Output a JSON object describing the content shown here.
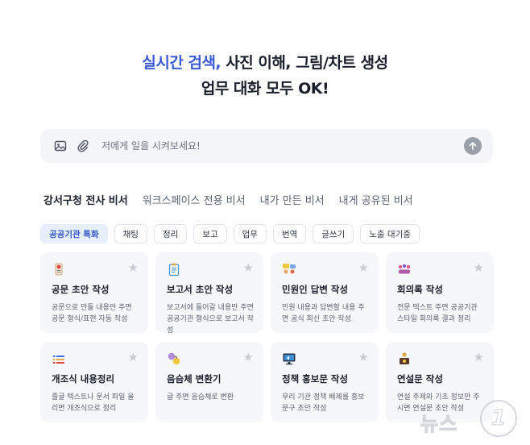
{
  "hero": {
    "accent": "실시간 검색,",
    "rest": " 사진 이해, 그림/차트 생성",
    "line2": "업무 대화 모두 OK!"
  },
  "chat": {
    "placeholder": "저에게 일을 시켜보세요!",
    "icons": [
      "image-icon",
      "paperclip-icon",
      "send-arrow-icon"
    ]
  },
  "tabs": [
    {
      "label": "강서구청 전사 비서",
      "active": true
    },
    {
      "label": "워크스페이스 전용 비서",
      "active": false
    },
    {
      "label": "내가 만든 비서",
      "active": false
    },
    {
      "label": "내게 공유된 비서",
      "active": false
    }
  ],
  "chips": [
    {
      "label": "공공기관 특화",
      "active": true
    },
    {
      "label": "채팅"
    },
    {
      "label": "정리"
    },
    {
      "label": "보고"
    },
    {
      "label": "업무"
    },
    {
      "label": "번역"
    },
    {
      "label": "글쓰기"
    },
    {
      "label": "노출 대기중"
    }
  ],
  "cards": [
    {
      "title": "공문 초안 작성",
      "desc": "공문으로 만들 내용만 주면 공문 형식/표현 자동 작성",
      "icon": "document-seal-icon"
    },
    {
      "title": "보고서 초안 작성",
      "desc": "보고서에 들어갈 내용만 주면 공공기관 형식으로 보고서 작성",
      "icon": "clipboard-icon"
    },
    {
      "title": "민원인 답변 작성",
      "desc": "민원 내용과 답변할 내용 주면 공식 회신 초안 작성",
      "icon": "people-chat-icon"
    },
    {
      "title": "회의록 작성",
      "desc": "전문 텍스트 주면 공공기관 스타일 회의록 결과 정리",
      "icon": "meeting-group-icon"
    },
    {
      "title": "개조식 내용정리",
      "desc": "줄글 텍스트나 문서 파일 올리면 개조식으로 정리",
      "icon": "bullet-list-icon"
    },
    {
      "title": "음슴체 변환기",
      "desc": "글 주면 음슴체로 변환",
      "icon": "speech-bubbles-icon"
    },
    {
      "title": "정책 홍보문 작성",
      "desc": "우리 기관 정책 배제를 홍보 문구 초안 작성",
      "icon": "monitor-announce-icon"
    },
    {
      "title": "연설문 작성",
      "desc": "연설 주제와 기초 정보만 주시면 연설문 초안 작성",
      "icon": "podium-speaker-icon"
    }
  ],
  "watermark": {
    "text": "뉴스",
    "number": "1"
  },
  "colors": {
    "accent": "#3b5bd6",
    "chip_active_bg": "#e8effc",
    "card_bg": "#f6f7f9"
  }
}
